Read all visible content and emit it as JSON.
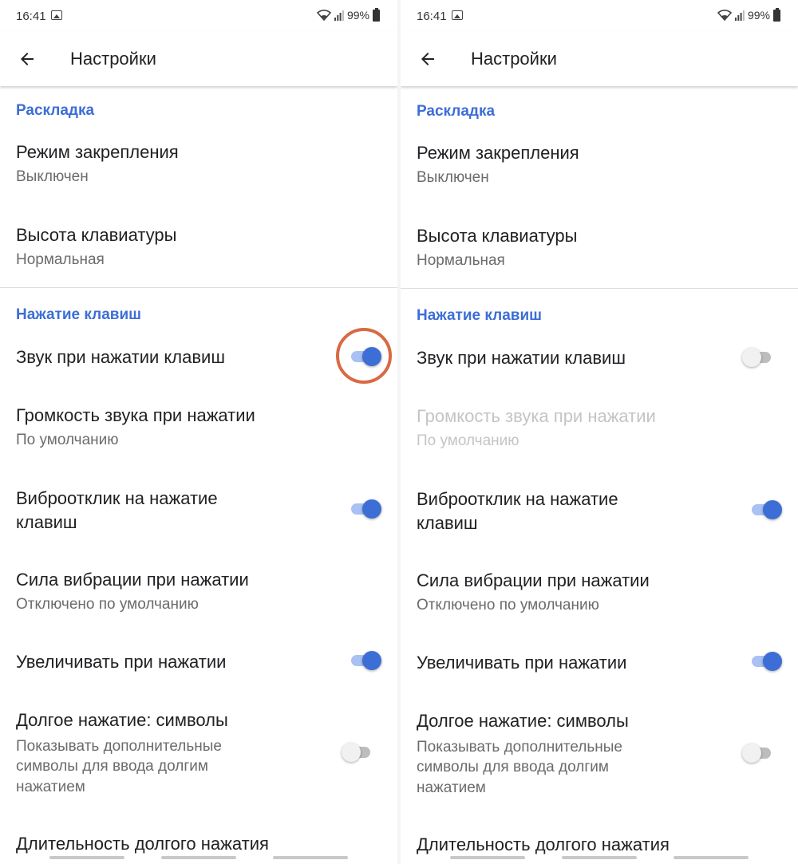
{
  "screens": [
    {
      "status": {
        "time": "16:41",
        "battery": "99%"
      },
      "app_bar": {
        "title": "Настройки"
      },
      "sections": {
        "layout": "Раскладка",
        "keypress": "Нажатие клавиш"
      },
      "prefs": {
        "pin_mode": {
          "title": "Режим закрепления",
          "summary": "Выключен"
        },
        "keyboard_height": {
          "title": "Высота клавиатуры",
          "summary": "Нормальная"
        },
        "key_sound": {
          "title": "Звук при нажатии клавиш",
          "enabled": true
        },
        "sound_volume": {
          "title": "Громкость звука при нажатии",
          "summary": "По умолчанию"
        },
        "vibration": {
          "title_line1": "Виброотклик на нажатие",
          "title_line2": "клавиш",
          "enabled": true
        },
        "vibration_strength": {
          "title": "Сила вибрации при нажатии",
          "summary": "Отключено по умолчанию"
        },
        "popup": {
          "title": "Увеличивать при нажатии",
          "enabled": true
        },
        "long_press": {
          "title": "Долгое нажатие: символы",
          "summary_line1": "Показывать дополнительные",
          "summary_line2": "символы для ввода долгим",
          "summary_line3": "нажатием",
          "enabled": false
        },
        "long_press_duration": {
          "title": "Длительность долгого нажатия"
        }
      }
    },
    {
      "status": {
        "time": "16:41",
        "battery": "99%"
      },
      "app_bar": {
        "title": "Настройки"
      },
      "sections": {
        "layout": "Раскладка",
        "keypress": "Нажатие клавиш"
      },
      "prefs": {
        "pin_mode": {
          "title": "Режим закрепления",
          "summary": "Выключен"
        },
        "keyboard_height": {
          "title": "Высота клавиатуры",
          "summary": "Нормальная"
        },
        "key_sound": {
          "title": "Звук при нажатии клавиш",
          "enabled": false
        },
        "sound_volume": {
          "title": "Громкость звука при нажатии",
          "summary": "По умолчанию"
        },
        "vibration": {
          "title_line1": "Виброотклик на нажатие",
          "title_line2": "клавиш",
          "enabled": true
        },
        "vibration_strength": {
          "title": "Сила вибрации при нажатии",
          "summary": "Отключено по умолчанию"
        },
        "popup": {
          "title": "Увеличивать при нажатии",
          "enabled": true
        },
        "long_press": {
          "title": "Долгое нажатие: символы",
          "summary_line1": "Показывать дополнительные",
          "summary_line2": "символы для ввода долгим",
          "summary_line3": "нажатием",
          "enabled": false
        },
        "long_press_duration": {
          "title": "Длительность долгого нажатия"
        }
      }
    }
  ],
  "colors": {
    "accent": "#3d6ed6",
    "highlight": "#d86a43"
  },
  "icons": {
    "back": "arrow-back-icon",
    "wifi": "wifi-icon",
    "signal": "signal-icon",
    "battery": "battery-icon",
    "gallery": "image-icon"
  }
}
